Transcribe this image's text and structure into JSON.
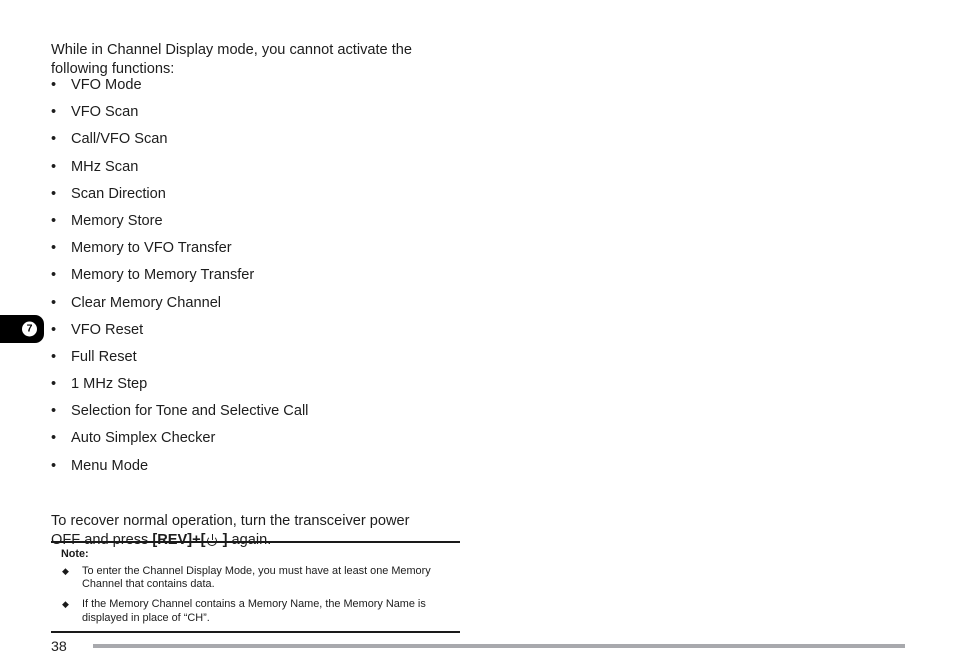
{
  "document": {
    "intro_paragraph": "While in Channel Display mode, you cannot activate the following functions:",
    "restricted_functions": [
      "VFO Mode",
      "VFO Scan",
      "Call/VFO Scan",
      "MHz Scan",
      "Scan Direction",
      "Memory Store",
      "Memory to VFO Transfer",
      "Memory to Memory Transfer",
      "Clear Memory Channel",
      "VFO Reset",
      "Full Reset",
      "1 MHz Step",
      "Selection for Tone and Selective Call",
      "Auto Simplex Checker",
      "Menu Mode"
    ],
    "bullet_marker": "•",
    "recovery": {
      "line1": "To recover normal operation, turn the transceiver power",
      "line2_before_key": "OFF and press ",
      "key_rev": "[REV]",
      "plus": "+[",
      "power_icon_name": "power-icon",
      "bracket_close": " ]",
      "line2_after_key": " again."
    },
    "note": {
      "title": "Note:",
      "marker": "◆",
      "items": [
        "To enter the Channel Display Mode, you must have at least one Memory Channel that contains data.",
        "If the Memory Channel contains a Memory Name, the Memory Name is displayed in place of “CH”."
      ]
    },
    "chapter_tab": {
      "number": "7"
    },
    "footer": {
      "page_number": "38"
    },
    "colors": {
      "text": "#1d1d1d",
      "tab_background": "#000000",
      "tab_number": "#000000",
      "footer_rule": "#a8a9ad",
      "note_rule": "#1a1a1a",
      "page_background": "#ffffff"
    }
  }
}
